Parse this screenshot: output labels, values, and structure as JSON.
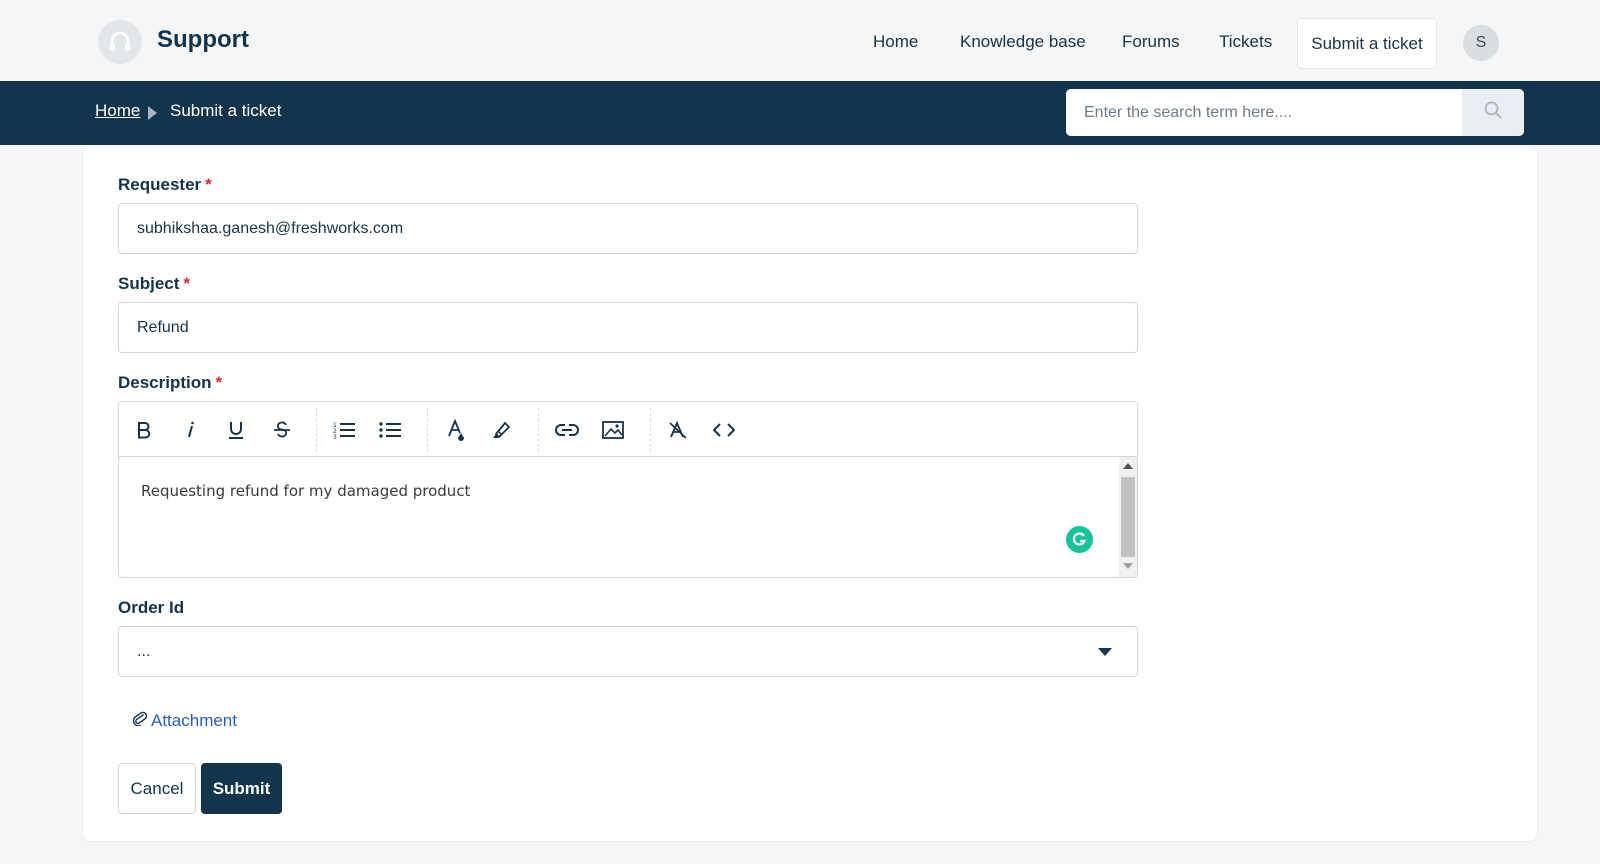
{
  "header": {
    "brand": "Support",
    "nav": [
      "Home",
      "Knowledge base",
      "Forums",
      "Tickets"
    ],
    "cta": "Submit a ticket",
    "avatar_initial": "S"
  },
  "breadcrumb": {
    "home": "Home",
    "current": "Submit a ticket"
  },
  "search": {
    "placeholder": "Enter the search term here...."
  },
  "form": {
    "requester": {
      "label": "Requester",
      "required": "*",
      "value": "subhikshaa.ganesh@freshworks.com"
    },
    "subject": {
      "label": "Subject",
      "required": "*",
      "value": "Refund"
    },
    "description": {
      "label": "Description",
      "required": "*",
      "value": "Requesting refund for my damaged product",
      "toolbar": [
        "bold-icon",
        "italic-icon",
        "underline-icon",
        "strikethrough-icon",
        "ordered-list-icon",
        "bullet-list-icon",
        "font-color-icon",
        "highlight-icon",
        "link-icon",
        "image-icon",
        "clear-format-icon",
        "code-icon"
      ]
    },
    "order_id": {
      "label": "Order Id",
      "value": "..."
    },
    "attachment": "Attachment",
    "cancel": "Cancel",
    "submit": "Submit"
  },
  "colors": {
    "primary": "#12344d",
    "required": "#d72d30",
    "link": "#2c5cc5",
    "grammarly": "#15c39a"
  }
}
